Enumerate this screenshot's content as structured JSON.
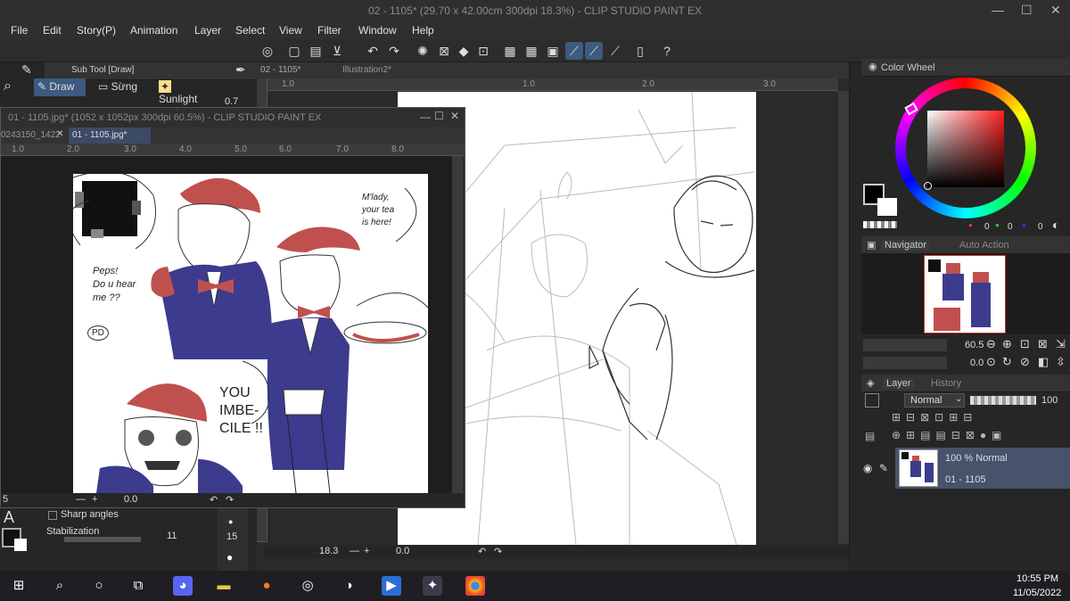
{
  "window": {
    "title": "02 - 1105* (29.70 x 42.00cm 300dpi 18.3%) - CLIP STUDIO PAINT EX",
    "minimize": "—",
    "maximize": "☐",
    "close": "✕"
  },
  "menu": [
    "File",
    "Edit",
    "Story(P)",
    "Animation",
    "Layer",
    "Select",
    "View",
    "Filter",
    "Window",
    "Help"
  ],
  "subtool": {
    "header": "Sub Tool [Draw]",
    "items": [
      "Draw",
      "Sừng",
      "Sunlight"
    ],
    "value": "0.7"
  },
  "main_canvas": {
    "tabs": [
      "02 - 1105*",
      "Illustration2*"
    ],
    "ruler": [
      "1.0",
      "1.0",
      "2.0",
      "3.0"
    ],
    "zoom": "18.3",
    "angle": "0.0"
  },
  "float_window": {
    "title": "01 - 1105.jpg* (1052 x 1052px 300dpi 60.5%) - CLIP STUDIO PAINT EX",
    "tabs": [
      "0243150_1422",
      "01 - 1105.jpg*"
    ],
    "ruler": [
      "1.0",
      "2.0",
      "3.0",
      "4.0",
      "5.0",
      "6.0",
      "7.0",
      "8.0"
    ],
    "zoom": "5",
    "angle": "0.0"
  },
  "art_text": {
    "mlady": "M'lady,\nyour tea\nis here!",
    "peps": "Peps!\nDo u hear\nme ??",
    "pd": "PD",
    "imbecile": "YOU\nIMBE-\nCILE !!"
  },
  "tool_property": {
    "sharp_angles": "Sharp angles",
    "stabilization": "Stabilization",
    "stab_value": "11",
    "brush_size": "15"
  },
  "color": {
    "panel": "Color Wheel",
    "r": "0",
    "g": "0",
    "b": "0",
    "main": "#000000",
    "sub": "#ffffff"
  },
  "navigator": {
    "tab": "Navigator",
    "tab2": "Auto Action",
    "zoom": "60.5",
    "angle": "0.0"
  },
  "layer": {
    "tab": "Layer",
    "tab2": "History",
    "blend": "Normal",
    "opacity": "100",
    "item_line1": "100 % Normal",
    "item_line2": "01 - 1105"
  },
  "taskbar": {
    "time": "10:55 PM",
    "date": "11/05/2022"
  }
}
